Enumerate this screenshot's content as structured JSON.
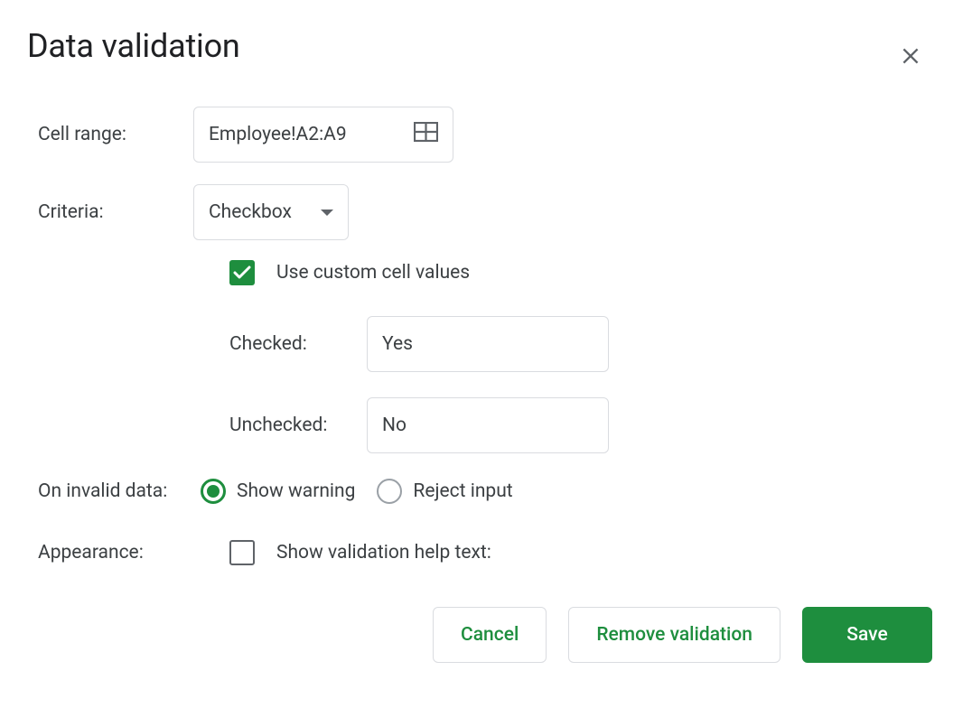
{
  "dialog": {
    "title": "Data validation"
  },
  "labels": {
    "cell_range": "Cell range:",
    "criteria": "Criteria:",
    "use_custom": "Use custom cell values",
    "checked": "Checked:",
    "unchecked": "Unchecked:",
    "invalid_data": "On invalid data:",
    "show_warning": "Show warning",
    "reject_input": "Reject input",
    "appearance": "Appearance:",
    "show_help": "Show validation help text:"
  },
  "values": {
    "cell_range": "Employee!A2:A9",
    "criteria": "Checkbox",
    "checked_value": "Yes",
    "unchecked_value": "No"
  },
  "buttons": {
    "cancel": "Cancel",
    "remove": "Remove validation",
    "save": "Save"
  }
}
